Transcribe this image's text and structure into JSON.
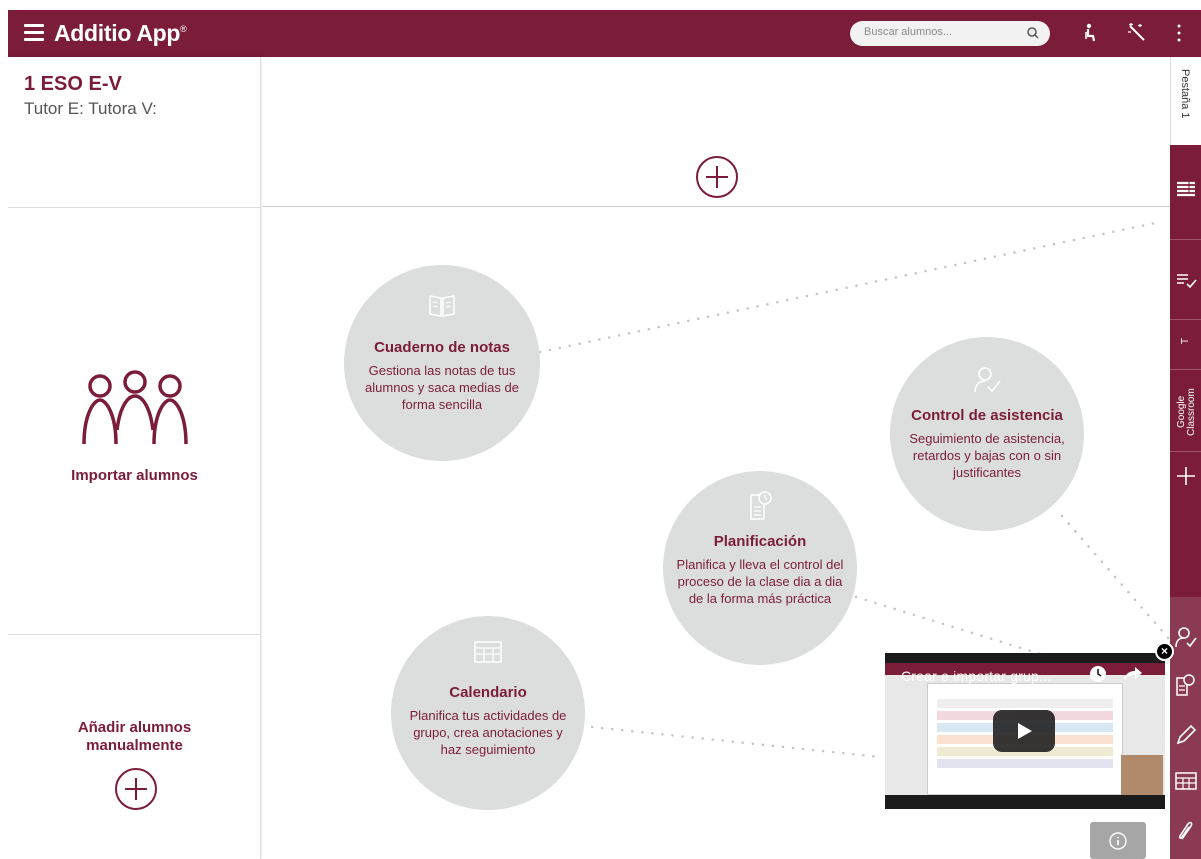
{
  "app": {
    "name": "Additio App",
    "trademark": "®"
  },
  "search": {
    "placeholder": "Buscar alumnos..."
  },
  "toolbar": {
    "icons": [
      "seat-plan-icon",
      "magic-wand-icon",
      "more-vert-icon"
    ]
  },
  "class_info": {
    "title": "1 ESO E-V",
    "tutor": "Tutor E: Tutora V:"
  },
  "left_panel": {
    "import_label": "Importar alumnos",
    "add_label": "Añadir alumnos manualmente"
  },
  "features": [
    {
      "icon": "book-icon",
      "title": "Cuaderno de notas",
      "desc": "Gestiona las notas de tus alumnos y saca medias de forma sencilla"
    },
    {
      "icon": "attendance-icon",
      "title": "Control de asistencia",
      "desc": "Seguimiento de asistencia, retardos y bajas con o sin justificantes"
    },
    {
      "icon": "planning-icon",
      "title": "Planificación",
      "desc": "Planifica y lleva el control del proceso de la clase dia a dia de la forma más práctica"
    },
    {
      "icon": "calendar-icon",
      "title": "Calendario",
      "desc": "Planifica tus actividades de grupo, crea anotaciones y haz seguimiento"
    }
  ],
  "right_bar": {
    "tab1": "Pestaña 1",
    "tab_t": "T",
    "google": "Google Classroom"
  },
  "video": {
    "title": "Crear e importar grup...",
    "close": "×"
  },
  "colors": {
    "brand": "#7b1c38",
    "feature_bg": "#dcdedd"
  }
}
